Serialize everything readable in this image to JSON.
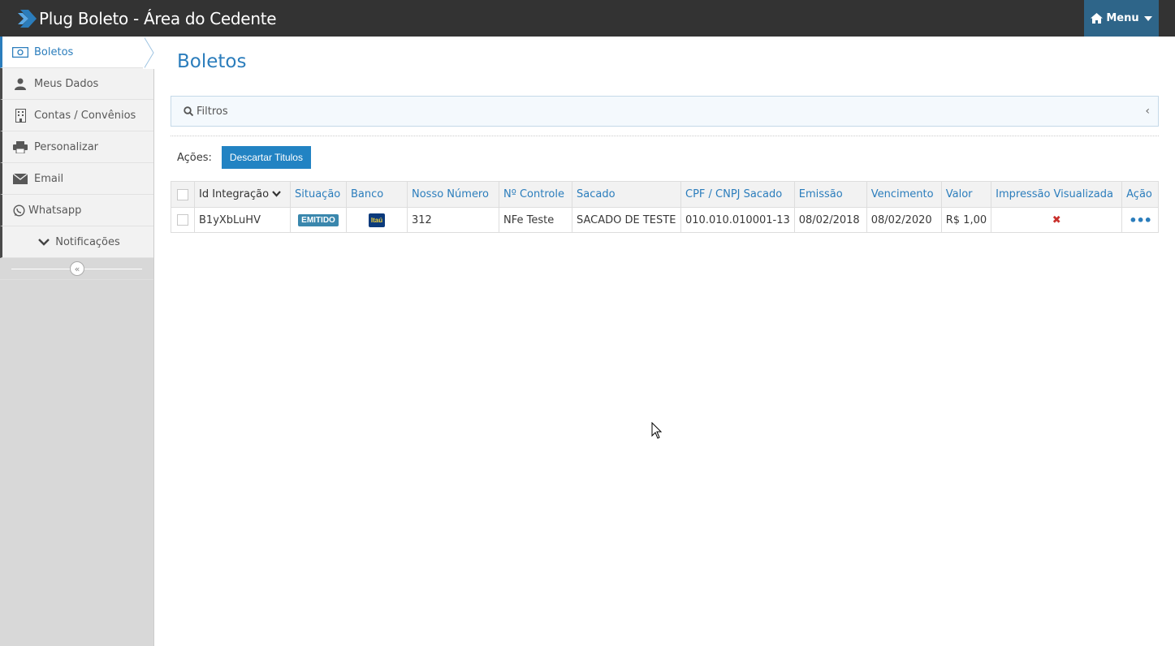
{
  "header": {
    "title": "Plug Boleto - Área do Cedente",
    "menu_label": "Menu",
    "colors": {
      "navbar": "#333333",
      "menu": "#2e6589"
    }
  },
  "sidebar": {
    "items": [
      {
        "label": "Boletos",
        "icon": "money-icon"
      },
      {
        "label": "Meus Dados",
        "icon": "user-icon"
      },
      {
        "label": "Contas / Convênios",
        "icon": "building-icon"
      },
      {
        "label": "Personalizar",
        "icon": "print-icon"
      },
      {
        "label": "Email",
        "icon": "envelope-icon"
      },
      {
        "label": "Whatsapp",
        "icon": "whatsapp-icon"
      },
      {
        "label": "Notificações",
        "icon": "chevron-down-icon"
      }
    ],
    "collapse_icon": "«"
  },
  "main": {
    "title": "Boletos",
    "filters_label": "Filtros",
    "filters_chevron": "‹",
    "actions_label": "Ações:",
    "discard_button": "Descartar Titulos"
  },
  "table": {
    "columns": [
      "Id Integração",
      "Situação",
      "Banco",
      "Nosso Número",
      "Nº Controle",
      "Sacado",
      "CPF / CNPJ Sacado",
      "Emissão",
      "Vencimento",
      "Valor",
      "Impressão Visualizada",
      "Ação"
    ],
    "rows": [
      {
        "id": "B1yXbLuHV",
        "situacao": "EMITIDO",
        "banco": "Itaú",
        "nosso_numero": "312",
        "controle": "NFe Teste",
        "sacado": "SACADO DE TESTE",
        "cpf_cnpj": "010.010.010001-13",
        "emissao": "08/02/2018",
        "vencimento": "08/02/2020",
        "valor": "R$ 1,00",
        "impressao": "✖",
        "acao": "•••"
      }
    ]
  }
}
